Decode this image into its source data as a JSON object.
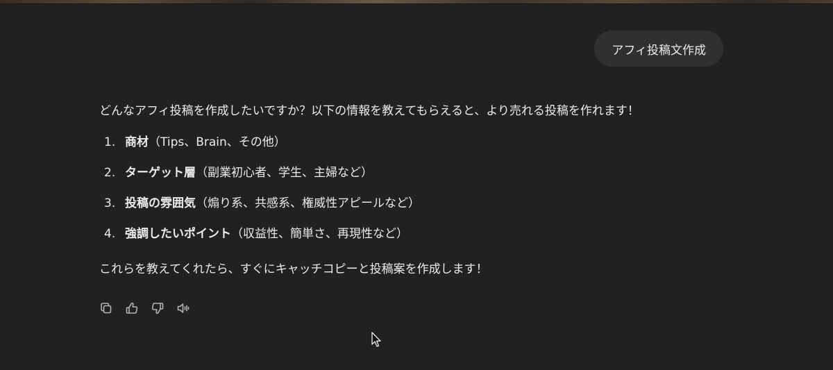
{
  "user_message": "アフィ投稿文作成",
  "assistant": {
    "intro": "どんなアフィ投稿を作成したいですか？以下の情報を教えてもらえると、より売れる投稿を作れます！",
    "items": [
      {
        "num": "1.",
        "term": "商材",
        "detail": "（Tips、Brain、その他）"
      },
      {
        "num": "2.",
        "term": "ターゲット層",
        "detail": "（副業初心者、学生、主婦など）"
      },
      {
        "num": "3.",
        "term": "投稿の雰囲気",
        "detail": "（煽り系、共感系、権威性アピールなど）"
      },
      {
        "num": "4.",
        "term": "強調したいポイント",
        "detail": "（収益性、簡単さ、再現性など）"
      }
    ],
    "outro": "これらを教えてくれたら、すぐにキャッチコピーと投稿案を作成します！"
  },
  "actions": [
    {
      "icon": "copy-icon"
    },
    {
      "icon": "thumbs-up-icon"
    },
    {
      "icon": "thumbs-down-icon"
    },
    {
      "icon": "speaker-icon"
    }
  ],
  "colors": {
    "background": "#212121",
    "bubble": "#303030",
    "text": "#ececec",
    "icon": "#b4b4b4"
  }
}
